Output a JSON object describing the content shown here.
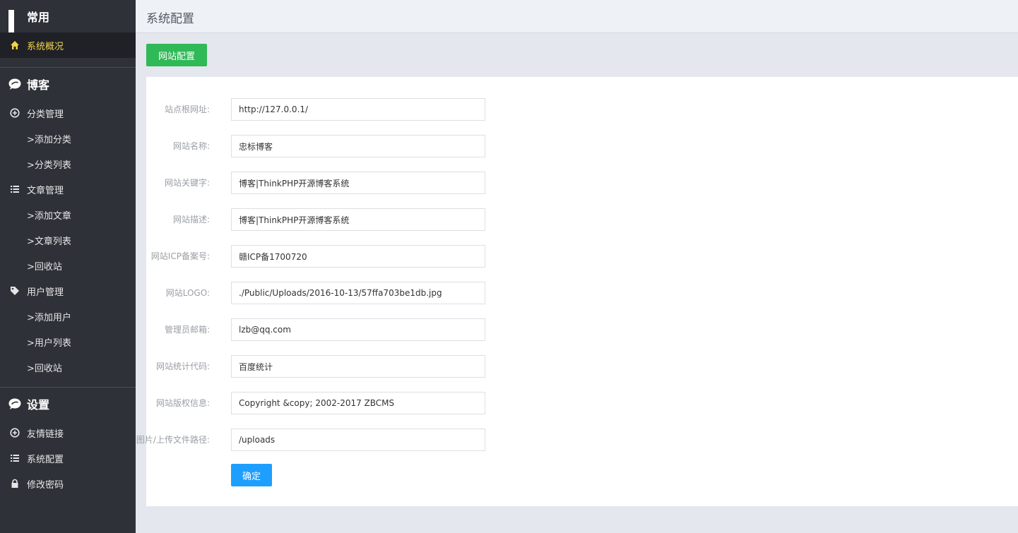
{
  "sidebar": {
    "sections": [
      {
        "title": "常用",
        "icon": "grid-icon",
        "items": [
          {
            "label": "系统概况",
            "icon": "home-icon",
            "active": true
          }
        ]
      },
      {
        "title": "博客",
        "icon": "chat-icon",
        "items": [
          {
            "label": "分类管理",
            "icon": "plus-circle-icon",
            "subs": [
              ">添加分类",
              ">分类列表"
            ]
          },
          {
            "label": "文章管理",
            "icon": "list-icon",
            "subs": [
              ">添加文章",
              ">文章列表",
              ">回收站"
            ]
          },
          {
            "label": "用户管理",
            "icon": "tag-icon",
            "subs": [
              ">添加用户",
              ">用户列表",
              ">回收站"
            ]
          }
        ]
      },
      {
        "title": "设置",
        "icon": "chat-icon",
        "items": [
          {
            "label": "友情链接",
            "icon": "plus-circle-icon"
          },
          {
            "label": "系统配置",
            "icon": "list-icon"
          },
          {
            "label": "修改密码",
            "icon": "lock-icon"
          }
        ]
      }
    ]
  },
  "header": {
    "title": "系统配置"
  },
  "tab": {
    "label": "网站配置"
  },
  "form": {
    "fields": [
      {
        "label": "站点根网址:",
        "value": "http://127.0.0.1/"
      },
      {
        "label": "网站名称:",
        "value": "忠标博客"
      },
      {
        "label": "网站关键字:",
        "value": "博客|ThinkPHP开源博客系统"
      },
      {
        "label": "网站描述:",
        "value": "博客|ThinkPHP开源博客系统"
      },
      {
        "label": "网站ICP备案号:",
        "value": "赣ICP备1700720"
      },
      {
        "label": "网站LOGO:",
        "value": "./Public/Uploads/2016-10-13/57ffa703be1db.jpg"
      },
      {
        "label": "管理员邮箱:",
        "value": "lzb@qq.com"
      },
      {
        "label": "网站统计代码:",
        "value": "百度统计"
      },
      {
        "label": "网站版权信息:",
        "value": "Copyright &copy; 2002-2017 ZBCMS"
      },
      {
        "label": "图片/上传文件路径:",
        "value": "/uploads"
      }
    ],
    "submit_label": "确定"
  },
  "colors": {
    "sidebar_bg": "#2e3138",
    "active_text": "#f1d44a",
    "tab_green": "#2fb957",
    "submit_blue": "#1e9fff"
  }
}
